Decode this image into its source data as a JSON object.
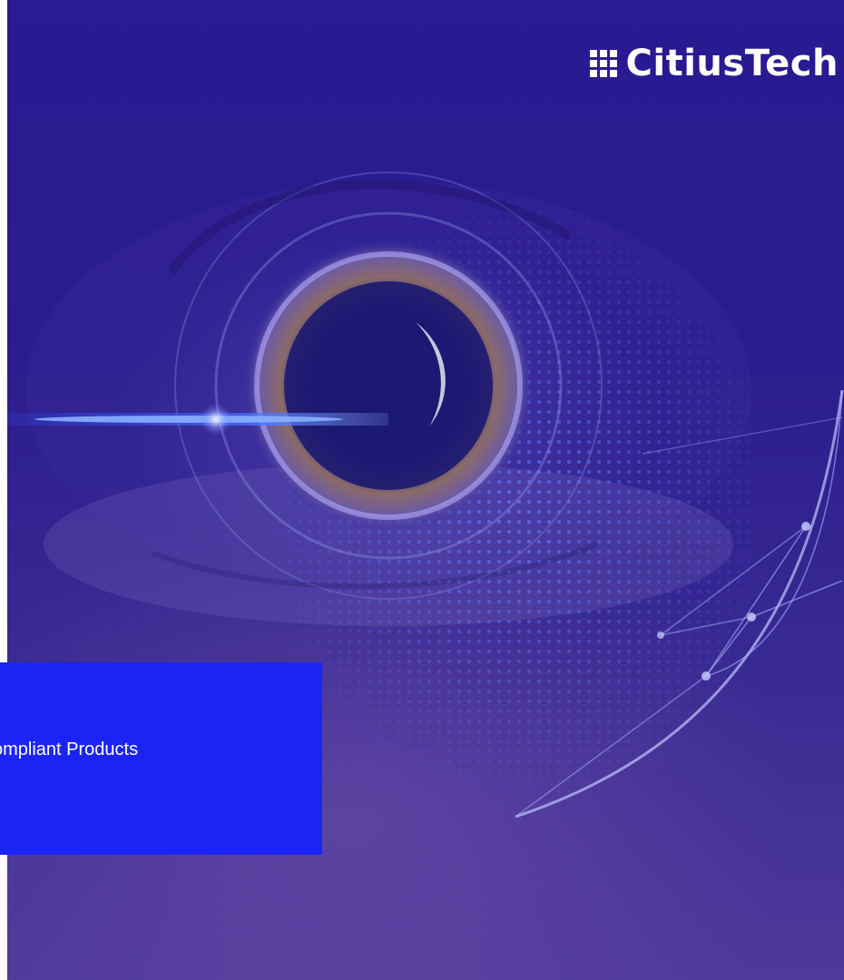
{
  "logo": {
    "text": "CitiusTech",
    "icon": "grid-logo-icon"
  },
  "title_box": {
    "text": "ompliant Products",
    "background": "#1c24f5"
  },
  "hero": {
    "icon": "eye-image",
    "colors": {
      "deep": "#2a1a93",
      "mid": "#3a2a92",
      "light": "#4f3a9a",
      "dot": "#5a7bff"
    }
  }
}
